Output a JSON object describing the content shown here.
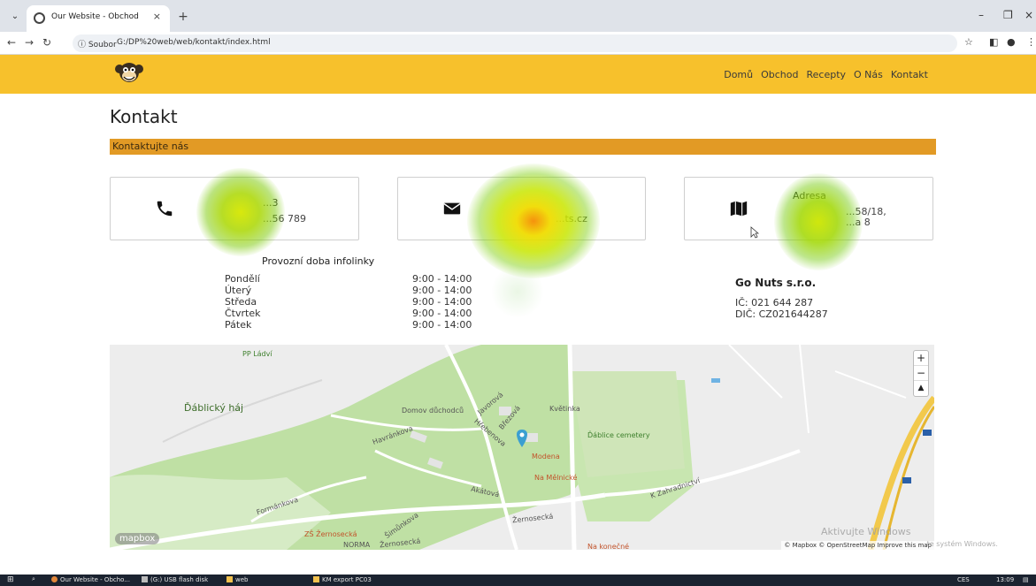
{
  "browser": {
    "tab_title": "Our Website - Obchod",
    "tab_close": "×",
    "new_tab": "+",
    "tab_dropdown": "⌄",
    "info_label": "ⓘ Soubor",
    "url": "G:/DP%20web/web/kontakt/index.html",
    "window_controls": [
      "–",
      "❐",
      "×"
    ]
  },
  "site": {
    "nav": [
      "Domů",
      "Obchod",
      "Recepty",
      "O Nás",
      "Kontakt"
    ],
    "page_title": "Kontakt",
    "section_title": "Kontaktujte nás",
    "cards": {
      "phone": {
        "title": "...3",
        "line1": "...56 789"
      },
      "email": {
        "line1": "...ts.cz"
      },
      "address": {
        "title": "Adresa",
        "line1": "...58/18,",
        "line2": "...a 8"
      }
    },
    "hours": {
      "title": "Provozní doba infolinky",
      "days": [
        "Pondělí",
        "Úterý",
        "Středa",
        "Čtvrtek",
        "Pátek"
      ],
      "times": [
        "9:00 - 14:00",
        "9:00 - 14:00",
        "9:00 - 14:00",
        "9:00 - 14:00",
        "9:00 - 14:00"
      ]
    },
    "company": {
      "name": "Go Nuts s.r.o.",
      "ic": "IČ: 021 644 287",
      "dic": "DIČ: CZ021644287"
    }
  },
  "map": {
    "labels": {
      "pp_ladvi": "PP Ládví",
      "dablicky_haj": "Ďáblický háj",
      "domov": "Domov důchodců",
      "kvetinka": "Květinka",
      "dablice_cemetery": "Ďáblice cemetery",
      "modena": "Modena",
      "na_mezi": "Na Mělnické",
      "akatova": "Akátová",
      "zernosecka1": "Žernosecká",
      "zernosecka2": "Žernosecká",
      "zs_zernosecka": "ZŠ Žernosecká",
      "norma": "NORMA",
      "formankova": "Formánkova",
      "simunkova": "Šimůnkova",
      "havrankova": "Havránkova",
      "k_zahradnictvi": "K Zahradnictví",
      "na_konecne": "Na konečné",
      "hrebenova": "Hřebenova",
      "brezova": "Březová",
      "jiverova": "Javorová"
    },
    "zoom_in": "+",
    "zoom_out": "−",
    "compass": "▲",
    "logo": "mapbox",
    "attribution": "© Mapbox © OpenStreetMap Improve this map"
  },
  "watermark": {
    "line1": "Aktivujte Windows",
    "line2": "...te systém Windows."
  },
  "taskbar": {
    "items": [
      "Our Website - Obcho...",
      "(G:) USB flash disk",
      "web",
      "KM export PC03"
    ],
    "tray_lang": "CES",
    "tray_time": "13:09"
  },
  "colors": {
    "header": "#f7c12c",
    "section_bar": "#e29a25",
    "map_green": "#bfe0a4",
    "marker": "#3b9fd1"
  }
}
